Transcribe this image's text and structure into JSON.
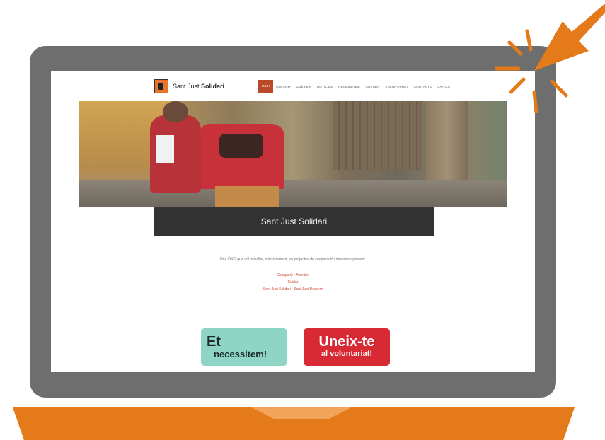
{
  "site": {
    "logo_text_plain": "Sant Just ",
    "logo_text_bold": "Solidari",
    "nav": [
      "Inici",
      "Qui som",
      "Què fem",
      "Notícies",
      "Necessitem",
      "Agenda",
      "Voluntariat",
      "Contacte",
      "Català"
    ],
    "nav_active": "Inici"
  },
  "hero": {
    "title": "Sant Just Solidari"
  },
  "content": {
    "intro": "Una ONG que vol treballar, solidàriament, en projectes de cooperació i desenvolupament.",
    "links": [
      "Compartir · Atendre",
      "Cuidar",
      "Sant Just Solidari · Sant Just Desvern"
    ]
  },
  "cta": {
    "green_big": "Et",
    "green_small": "necessitem!",
    "red_big": "Uneix-te",
    "red_small": "al voluntariat!"
  },
  "colors": {
    "frame": "#6e6e6e",
    "base": "#e47a1a",
    "cursor": "#e47a1a",
    "nav_active": "#b84a2a",
    "cta_green": "#8fd5c5",
    "cta_red": "#d72a35"
  }
}
